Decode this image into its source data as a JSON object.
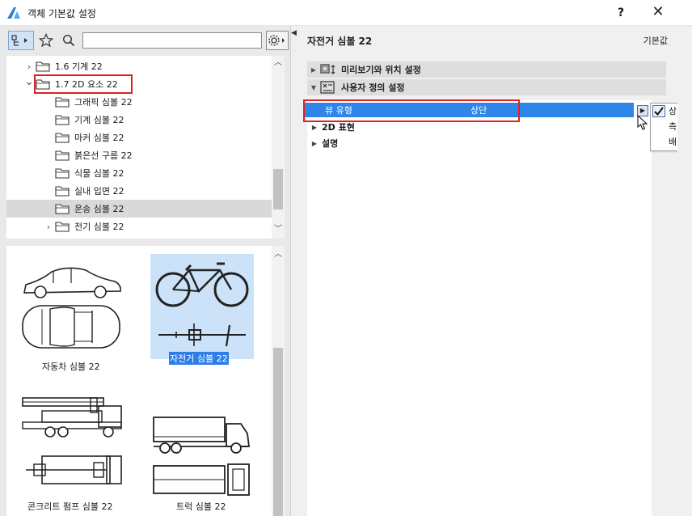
{
  "window": {
    "title": "객체 기본값 설정",
    "help_label": "?",
    "close_label": "✕"
  },
  "left": {
    "search": {
      "value": "",
      "placeholder": ""
    },
    "tree": [
      {
        "label": "1.6 기계 22",
        "level": 1,
        "chevron": "›",
        "selected": false
      },
      {
        "label": "1.7 2D 요소 22",
        "level": 1,
        "chevron": "⌄",
        "selected": false
      },
      {
        "label": "그래픽 심볼 22",
        "level": 2,
        "selected": false
      },
      {
        "label": "기계 심볼 22",
        "level": 2,
        "selected": false
      },
      {
        "label": "마커 심볼 22",
        "level": 2,
        "selected": false
      },
      {
        "label": "붉은선 구름 22",
        "level": 2,
        "selected": false
      },
      {
        "label": "식물 심볼 22",
        "level": 2,
        "selected": false
      },
      {
        "label": "실내 입면 22",
        "level": 2,
        "selected": false
      },
      {
        "label": "운송 심볼 22",
        "level": 2,
        "selected": true
      },
      {
        "label": "전기 심볼 22",
        "level": 2,
        "chevron": "›",
        "selected": false
      }
    ],
    "gallery": [
      {
        "label": "자동차 심볼 22",
        "selected": false,
        "icon": "car-icon"
      },
      {
        "label": "자전거 심볼 22",
        "selected": true,
        "icon": "bicycle-icon"
      },
      {
        "label": "콘크리트 펌프 심볼 22",
        "selected": false,
        "icon": "concrete-pump-truck-icon"
      },
      {
        "label": "트럭 심볼 22",
        "selected": false,
        "icon": "truck-icon"
      }
    ]
  },
  "right": {
    "title": "자전거 심볼 22",
    "default_label": "기본값",
    "sections": [
      {
        "label": "미리보기와 위치 설정",
        "expanded": false,
        "icon": "preview-position-icon"
      },
      {
        "label": "사용자 정의 설정",
        "expanded": true,
        "icon": "custom-settings-icon"
      }
    ],
    "params": [
      {
        "name": "뷰 유형",
        "value": "상단",
        "active": true
      },
      {
        "name": "2D 표현",
        "value": "",
        "group": true
      },
      {
        "name": "설명",
        "value": "",
        "group": true
      }
    ],
    "dropdown": {
      "options": [
        "상단",
        "측면",
        "배면"
      ],
      "checked": "상단"
    }
  },
  "colors": {
    "selection_blue": "#2f86e8",
    "highlight_red": "#e0201f",
    "panel_gray": "#e9e9e9"
  }
}
